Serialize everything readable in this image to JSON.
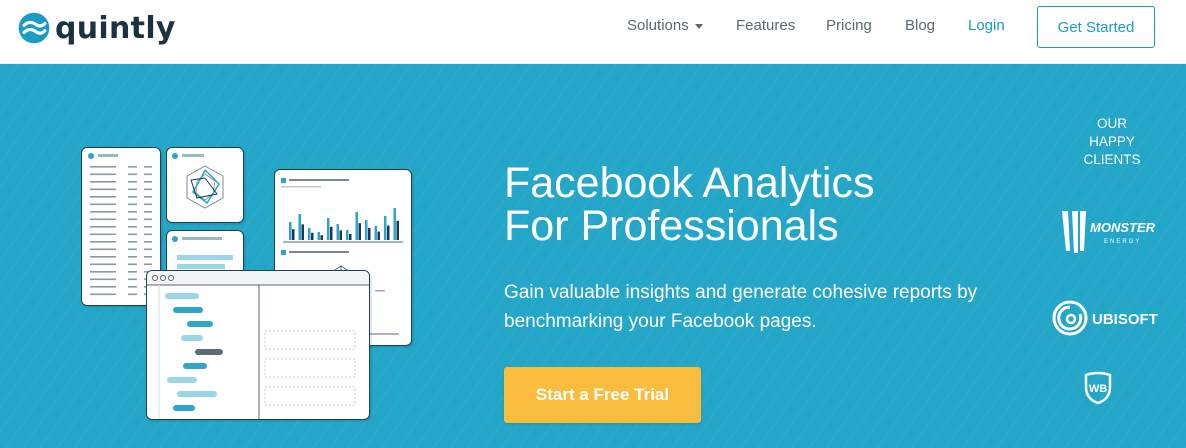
{
  "brand": {
    "name": "quintly",
    "colors": {
      "accent": "#1a9cc5",
      "hero_bg": "#24a6c8",
      "cta": "#f9bd3e",
      "logo_dark": "#1b3340"
    }
  },
  "nav": {
    "items": [
      {
        "label": "Solutions",
        "icon": "chevron-down-icon"
      },
      {
        "label": "Features"
      },
      {
        "label": "Pricing"
      },
      {
        "label": "Blog"
      },
      {
        "label": "Login"
      }
    ],
    "cta_label": "Get Started"
  },
  "hero": {
    "title_lines": [
      "Facebook Analytics",
      "For Professionals"
    ],
    "subtitle_lines": [
      "Gain valuable insights and generate cohesive reports by",
      "benchmarking your Facebook pages."
    ],
    "cta_label": "Start a Free Trial",
    "illustration": "dashboard-reports-illustration"
  },
  "clients": {
    "heading_lines": [
      "OUR",
      "HAPPY",
      "CLIENTS"
    ],
    "logos": [
      {
        "name": "monster-energy-logo",
        "text": "MONSTER",
        "subtext": "ENERGY"
      },
      {
        "name": "ubisoft-logo",
        "text": "UBISOFT"
      },
      {
        "name": "warner-bros-logo",
        "text": "WB"
      }
    ]
  }
}
